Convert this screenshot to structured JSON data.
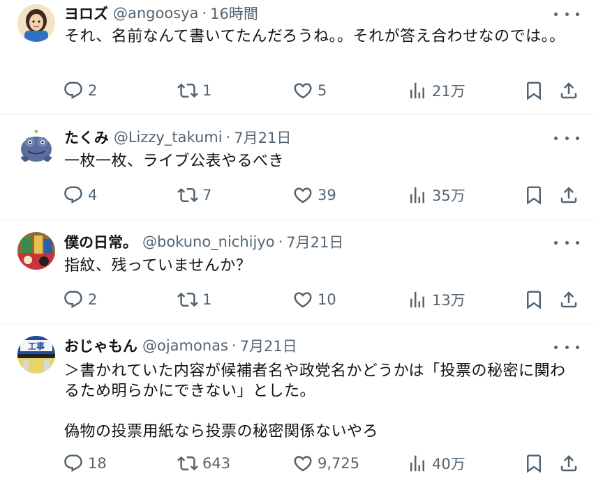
{
  "tweets": [
    {
      "display_name": "ヨロズ",
      "handle": "@angoosya",
      "separator": "·",
      "time": "16時間",
      "text": "それ、名前なんて書いてたんだろうね。。それが答え合わせなのでは。。",
      "replies": "2",
      "retweets": "1",
      "likes": "5",
      "views": "21万"
    },
    {
      "display_name": "たくみ",
      "handle": "@Lizzy_takumi",
      "separator": "·",
      "time": "7月21日",
      "text": "一枚一枚、ライブ公表やるべき",
      "replies": "4",
      "retweets": "7",
      "likes": "39",
      "views": "35万"
    },
    {
      "display_name": "僕の日常。",
      "handle": "@bokuno_nichijyo",
      "separator": "·",
      "time": "7月21日",
      "text": "指紋、残っていませんか？",
      "replies": "2",
      "retweets": "1",
      "likes": "10",
      "views": "13万"
    },
    {
      "display_name": "おじゃもん",
      "handle": "@ojamonas",
      "separator": "·",
      "time": "7月21日",
      "text": "＞書かれていた内容が候補者名や政党名かどうかは「投票の秘密に関わるため明らかにできない」とした。\n\n偽物の投票用紙なら投票の秘密関係ないやろ",
      "replies": "18",
      "retweets": "643",
      "likes": "9,725",
      "views": "40万",
      "avatar_text": "工事"
    }
  ],
  "colors": {
    "text_primary": "#0f1419",
    "text_secondary": "#536471",
    "divider": "#eff3f4"
  },
  "icons": [
    "reply-icon",
    "retweet-icon",
    "like-icon",
    "views-icon",
    "bookmark-icon",
    "share-icon",
    "more-icon"
  ]
}
